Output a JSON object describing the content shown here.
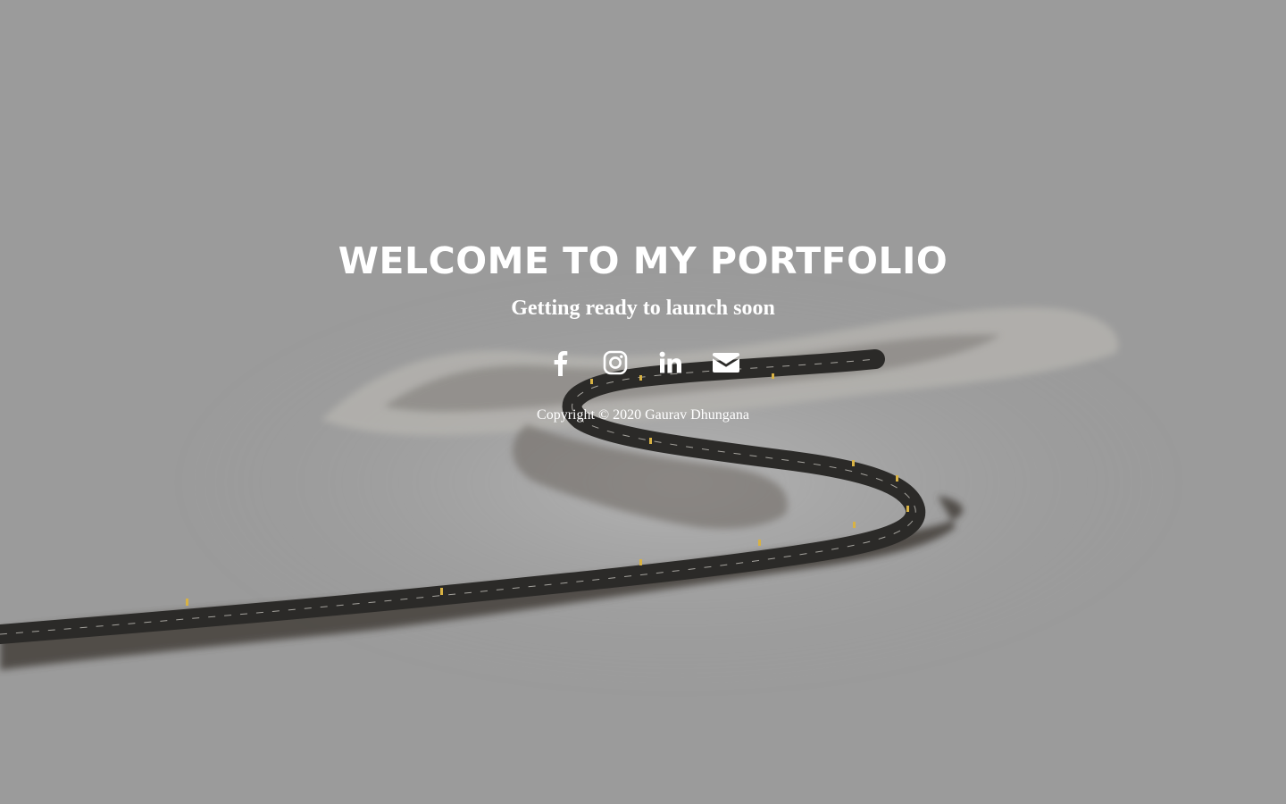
{
  "hero": {
    "title": "WELCOME TO MY PORTFOLIO",
    "subtitle": "Getting ready to launch soon"
  },
  "social": [
    {
      "name": "Facebook",
      "icon": "facebook-icon"
    },
    {
      "name": "Instagram",
      "icon": "instagram-icon"
    },
    {
      "name": "LinkedIn",
      "icon": "linkedin-icon"
    },
    {
      "name": "Email",
      "icon": "envelope-icon"
    }
  ],
  "footer": {
    "copyright": "Copyright © 2020 Gaurav Dhungana"
  },
  "colors": {
    "background": "#9b9b9b",
    "text": "#ffffff",
    "road": "#2b2a28"
  }
}
